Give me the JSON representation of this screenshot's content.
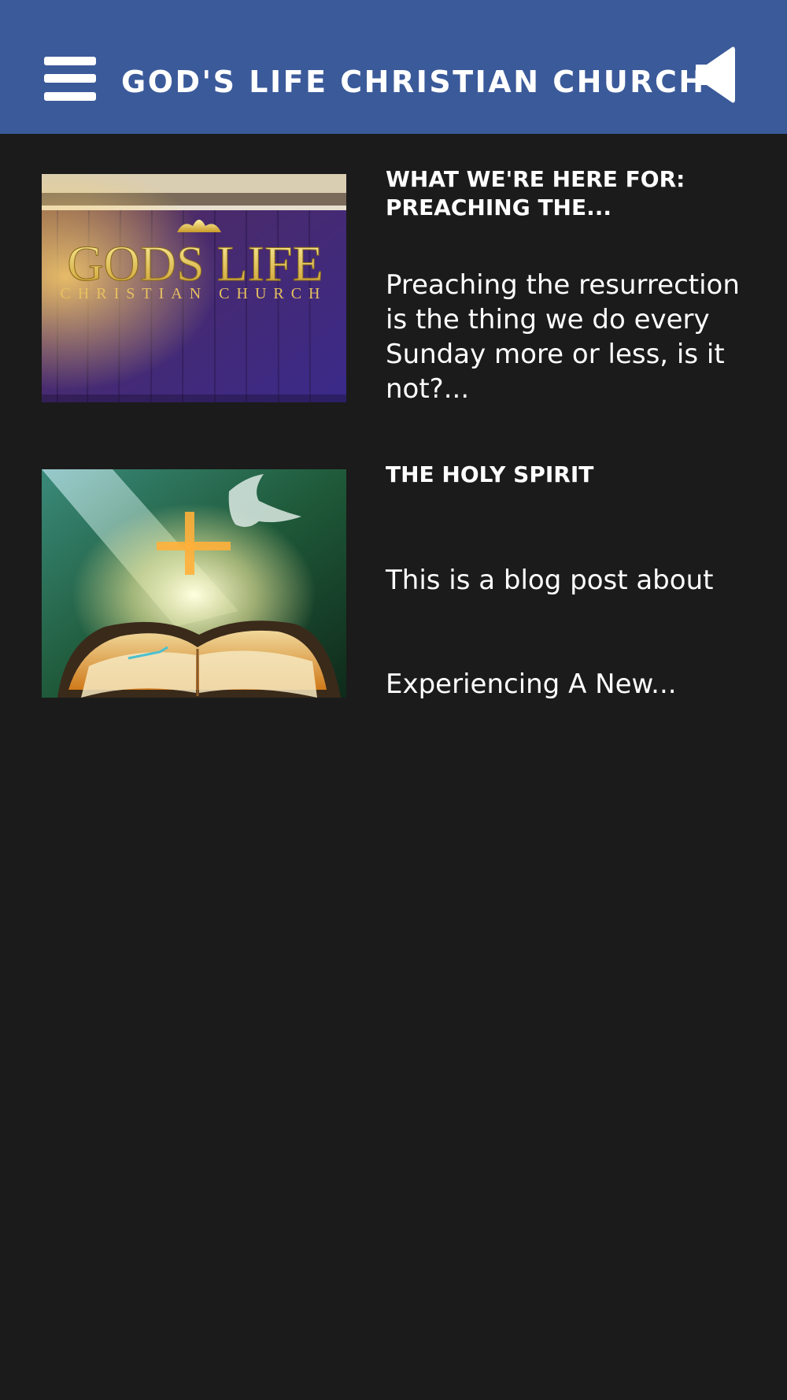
{
  "header": {
    "menu_icon": "hamburger-menu-icon",
    "title": "GOD'S LIFE CHRISTIAN CHURCH",
    "speaker_icon": "speaker-icon",
    "background_color": "#3b5a9a"
  },
  "posts": [
    {
      "image_label_line1": "GODS LIFE",
      "image_label_line2": "CHRISTIAN CHURCH",
      "title": "WHAT WE'RE HERE FOR: PREACHING THE...",
      "excerpt": "Preaching the resurrection is the thing we do every Sunday more or less, is it not?..."
    },
    {
      "title": "THE HOLY SPIRIT",
      "excerpt_line1": "This is a blog post about",
      "excerpt_line2": "Experiencing A New..."
    }
  ],
  "colors": {
    "page_background": "#1b1b1b",
    "text": "#ffffff"
  }
}
